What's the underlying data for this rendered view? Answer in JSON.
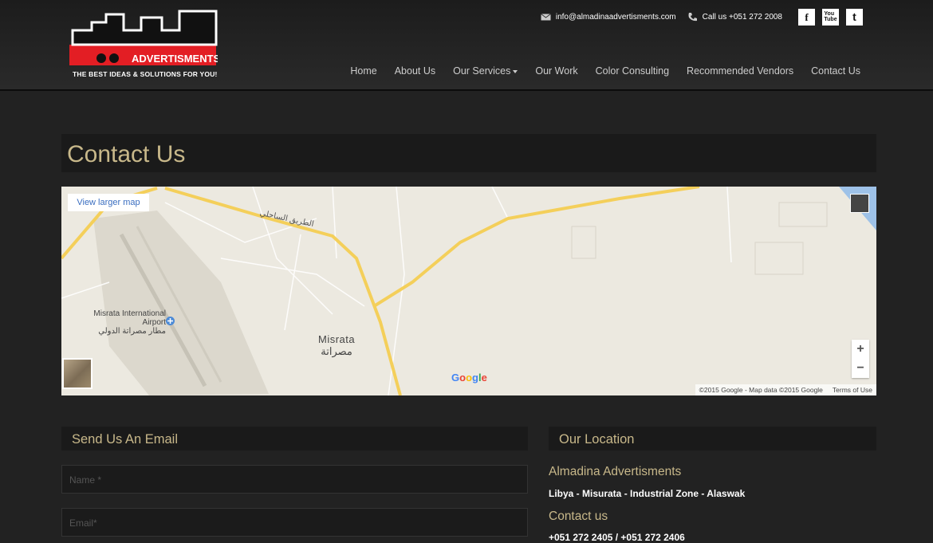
{
  "brand": {
    "logo_text": "ADVERTISMENTS",
    "tagline": "THE BEST IDEAS & SOLUTIONS FOR YOU!",
    "accent_color": "#e31e24"
  },
  "topbar": {
    "email": "info@almadinaadvertisments.com",
    "email_icon": "envelope-icon",
    "phone": "Call us +051 272 2008",
    "phone_icon": "phone-icon",
    "social": [
      {
        "name": "facebook-icon",
        "label": "f"
      },
      {
        "name": "youtube-icon",
        "label": "You\nTube"
      },
      {
        "name": "twitter-icon",
        "label": "t"
      }
    ]
  },
  "nav": {
    "items": [
      "Home",
      "About Us",
      "Our Services",
      "Our Work",
      "Color Consulting",
      "Recommended Vendors",
      "Contact Us"
    ]
  },
  "page": {
    "title": "Contact Us"
  },
  "map": {
    "view_larger": "View larger map",
    "city_en": "Misrata",
    "city_ar": "مصراتة",
    "airport_en": "Misrata International Airport",
    "airport_ar": "مطار مصراتة الدولي",
    "road_label": "الطريق الساحلي",
    "google_logo": "Google",
    "attribution": "©2015 Google - Map data ©2015 Google",
    "terms": "Terms of Use",
    "zoom_in": "+",
    "zoom_out": "−"
  },
  "form": {
    "heading": "Send Us An Email",
    "name_placeholder": "Name *",
    "email_placeholder": "Email*"
  },
  "location": {
    "heading": "Our Location",
    "company": "Almadina Advertisments",
    "address": "Libya - Misurata - Industrial Zone - Alaswak",
    "contact_heading": "Contact us",
    "phones": "+051 272 2405 / +051 272 2406"
  }
}
